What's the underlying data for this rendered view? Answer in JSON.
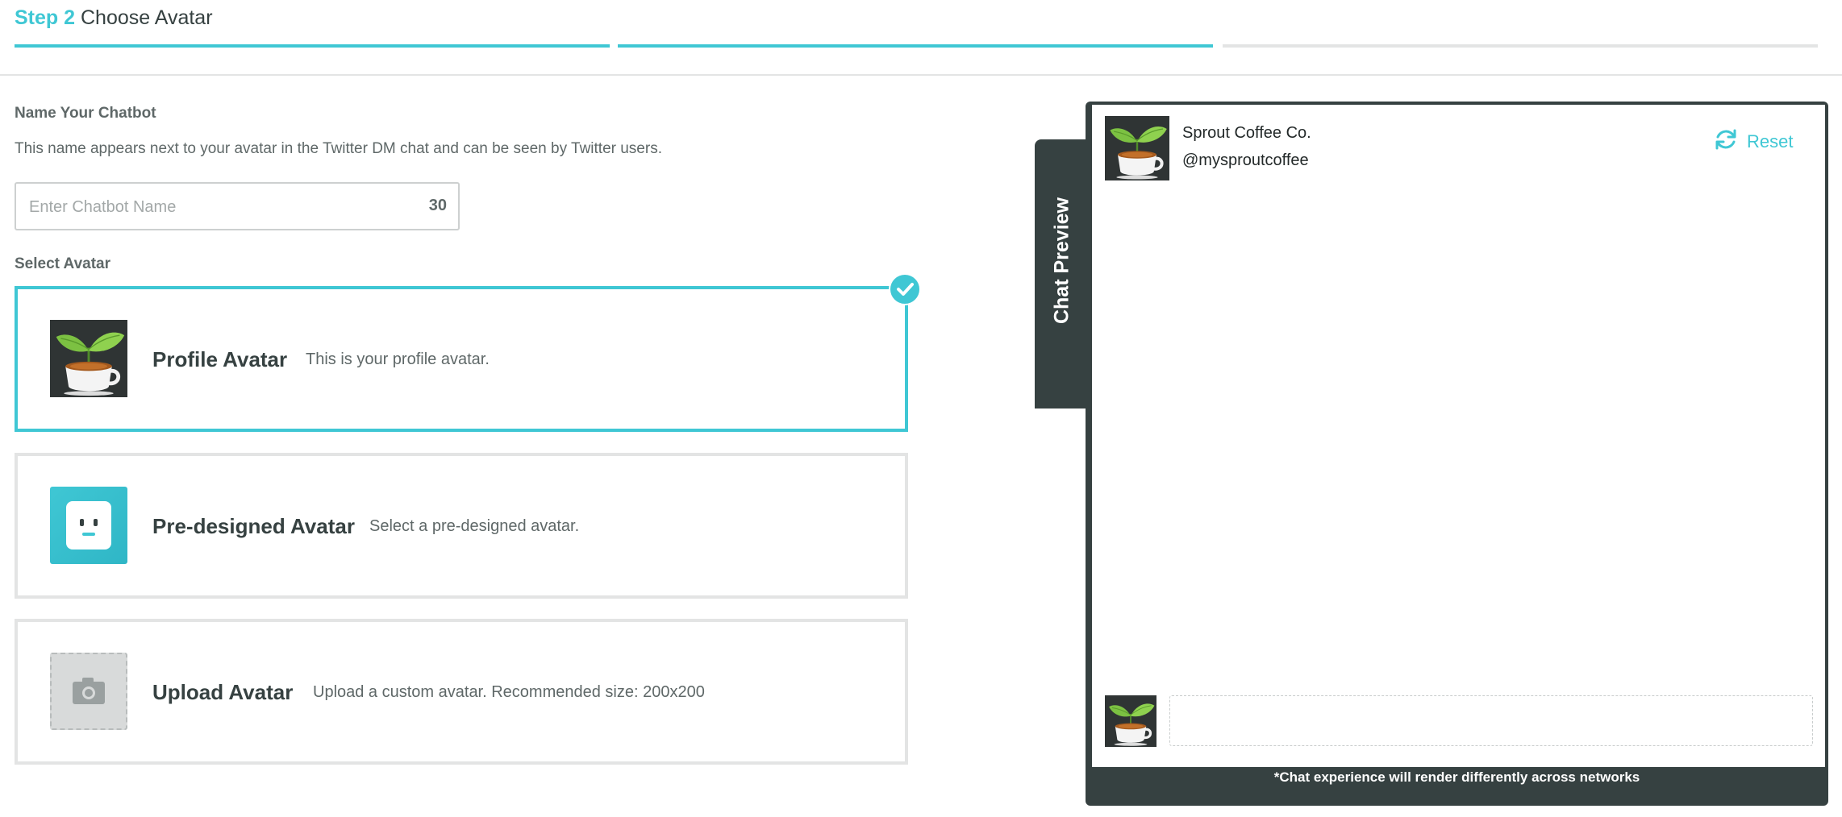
{
  "header": {
    "step_number": "Step 2",
    "step_title": "Choose Avatar"
  },
  "name_section": {
    "label": "Name Your Chatbot",
    "help": "This name appears next to your avatar in the Twitter DM chat and can be seen by Twitter users.",
    "placeholder": "Enter Chatbot Name",
    "char_count": "30"
  },
  "avatar_section": {
    "label": "Select Avatar",
    "options": [
      {
        "title": "Profile Avatar",
        "description": "This is your profile avatar."
      },
      {
        "title": "Pre-designed Avatar",
        "description": "Select a pre-designed avatar."
      },
      {
        "title": "Upload Avatar",
        "description": "Upload a custom avatar. Recommended size: 200x200"
      }
    ]
  },
  "preview": {
    "tab_label": "Chat Preview",
    "account_name": "Sprout Coffee Co.",
    "account_handle": "@mysproutcoffee",
    "reset_label": "Reset",
    "footer_note": "*Chat experience will render differently across networks"
  },
  "colors": {
    "accent": "#3fc7d4",
    "dark": "#364141",
    "border": "#e3e4e4"
  }
}
